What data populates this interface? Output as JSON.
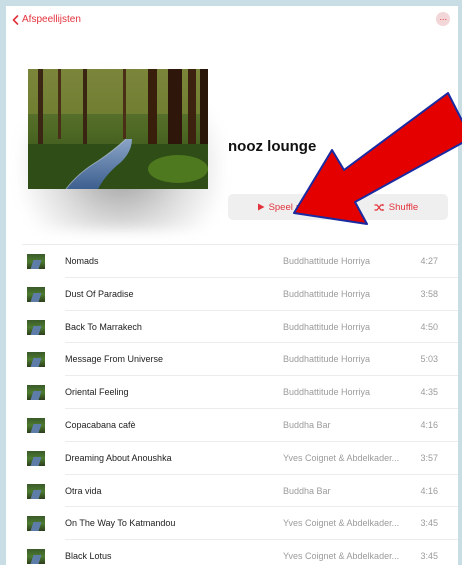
{
  "header": {
    "back_label": "Afspeellijsten",
    "more_label": "···"
  },
  "playlist": {
    "title": "nooz lounge",
    "play_label": "Speel af",
    "shuffle_label": "Shuffle"
  },
  "colors": {
    "accent": "#e2333c",
    "arrow": "#e50000"
  },
  "tracks": [
    {
      "title": "Nomads",
      "artist": "Buddhattitude Horriya",
      "duration": "4:27"
    },
    {
      "title": "Dust Of Paradise",
      "artist": "Buddhattitude Horriya",
      "duration": "3:58"
    },
    {
      "title": "Back To Marrakech",
      "artist": "Buddhattitude Horriya",
      "duration": "4:50"
    },
    {
      "title": "Message From Universe",
      "artist": "Buddhattitude Horriya",
      "duration": "5:03"
    },
    {
      "title": "Oriental Feeling",
      "artist": "Buddhattitude Horriya",
      "duration": "4:35"
    },
    {
      "title": "Copacabana cafè",
      "artist": "Buddha Bar",
      "duration": "4:16"
    },
    {
      "title": "Dreaming About Anoushka",
      "artist": "Yves Coignet & Abdelkader...",
      "duration": "3:57"
    },
    {
      "title": "Otra vida",
      "artist": "Buddha Bar",
      "duration": "4:16"
    },
    {
      "title": "On The Way To Katmandou",
      "artist": "Yves Coignet & Abdelkader...",
      "duration": "3:45"
    },
    {
      "title": "Black Lotus",
      "artist": "Yves Coignet & Abdelkader...",
      "duration": "3:45"
    }
  ]
}
